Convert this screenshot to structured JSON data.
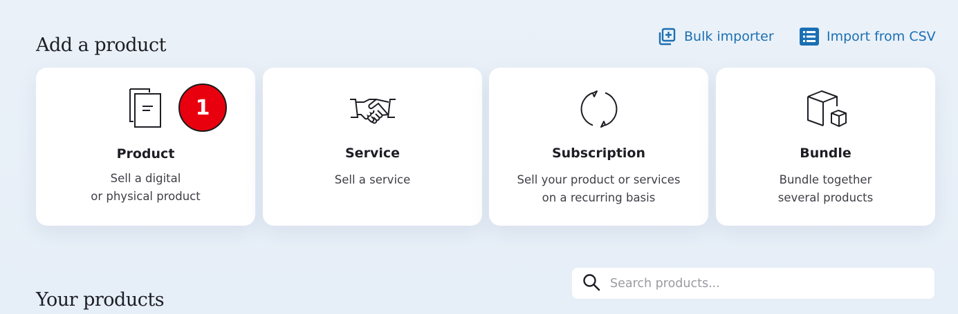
{
  "header": {
    "title": "Add a product",
    "actions": [
      {
        "label": "Bulk importer",
        "icon": "bulk-import-icon"
      },
      {
        "label": "Import from CSV",
        "icon": "csv-list-icon"
      }
    ]
  },
  "cards": [
    {
      "title": "Product",
      "desc_line1": "Sell a digital",
      "desc_line2": "or physical product",
      "icon": "documents-icon",
      "badge": "1"
    },
    {
      "title": "Service",
      "desc_line1": "Sell a service",
      "desc_line2": "",
      "icon": "handshake-icon"
    },
    {
      "title": "Subscription",
      "desc_line1": "Sell your product or services",
      "desc_line2": "on a recurring basis",
      "icon": "recurring-cycle-icon"
    },
    {
      "title": "Bundle",
      "desc_line1": "Bundle together",
      "desc_line2": "several products",
      "icon": "boxes-icon"
    }
  ],
  "products_section": {
    "title": "Your products",
    "search": {
      "placeholder": "Search products...",
      "value": "",
      "icon": "search-icon"
    }
  },
  "colors": {
    "accent": "#1a6fb3",
    "badge": "#e8000f",
    "background": "#e8f0f8",
    "card": "#ffffff"
  }
}
